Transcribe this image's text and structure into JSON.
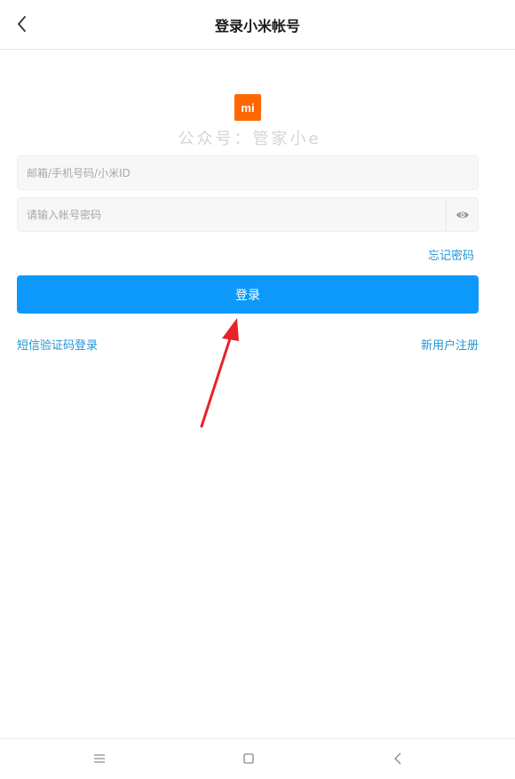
{
  "header": {
    "title": "登录小米帐号",
    "back_icon": "chevron-left-icon"
  },
  "logo": {
    "text": "mi",
    "color": "#ff6700"
  },
  "watermark": "公众号：管家小e",
  "form": {
    "account_placeholder": "邮箱/手机号码/小米ID",
    "password_placeholder": "请输入帐号密码",
    "eye_icon": "eye-icon",
    "forgot_label": "忘记密码",
    "login_label": "登录",
    "sms_login_label": "短信验证码登录",
    "register_label": "新用户注册"
  },
  "colors": {
    "primary": "#0d99fb",
    "link": "#2196d8",
    "annotation_arrow": "#e8232a"
  },
  "navbar": {
    "menu_icon": "menu-icon",
    "home_icon": "square-home-icon",
    "back_icon": "back-triangle-icon"
  }
}
